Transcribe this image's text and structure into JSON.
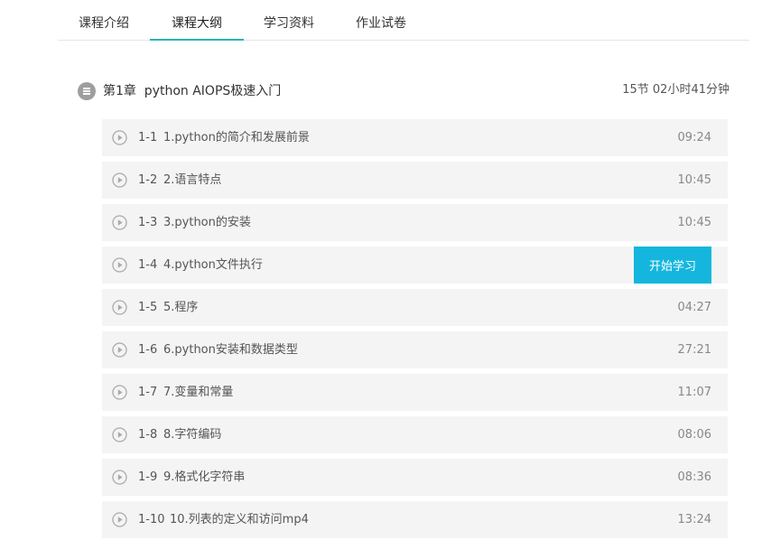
{
  "tabs": [
    {
      "label": "课程介绍"
    },
    {
      "label": "课程大纲"
    },
    {
      "label": "学习资料"
    },
    {
      "label": "作业试卷"
    }
  ],
  "active_tab": "课程大纲",
  "chapter": {
    "title": "第1章  python AIOPS极速入门",
    "meta": "15节 02小时41分钟"
  },
  "lessons": [
    {
      "num": "1-1",
      "title": "1.python的简介和发展前景",
      "duration": "09:24"
    },
    {
      "num": "1-2",
      "title": "2.语言特点",
      "duration": "10:45"
    },
    {
      "num": "1-3",
      "title": "3.python的安装",
      "duration": "10:45"
    },
    {
      "num": "1-4",
      "title": "4.python文件执行",
      "duration": "",
      "button": "开始学习"
    },
    {
      "num": "1-5",
      "title": "5.程序",
      "duration": "04:27"
    },
    {
      "num": "1-6",
      "title": "6.python安装和数据类型",
      "duration": "27:21"
    },
    {
      "num": "1-7",
      "title": "7.变量和常量",
      "duration": "11:07"
    },
    {
      "num": "1-8",
      "title": "8.字符编码",
      "duration": "08:06"
    },
    {
      "num": "1-9",
      "title": "9.格式化字符串",
      "duration": "08:36"
    },
    {
      "num": "1-10",
      "title": "10.列表的定义和访问mp4",
      "duration": "13:24"
    }
  ],
  "colors": {
    "accent": "#2bb3b1",
    "button": "#14b6de",
    "row_bg": "#f4f4f4"
  },
  "icons": {
    "chapter": "list-icon",
    "lesson": "play-circle-icon"
  }
}
